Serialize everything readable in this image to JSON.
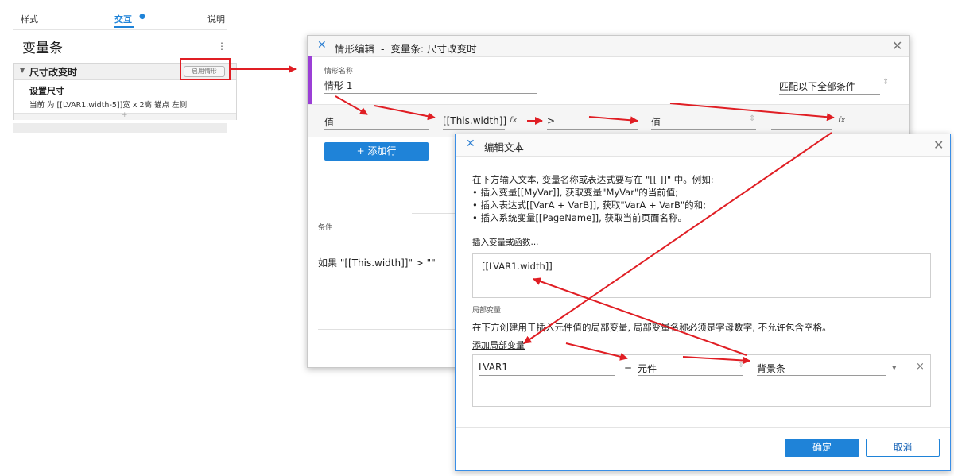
{
  "left_panel": {
    "tabs": [
      "样式",
      "交互",
      "说明"
    ],
    "title": "变量条",
    "more_glyph": "⋮",
    "case": {
      "name": "尺寸改变时",
      "enable_button": "启用情形",
      "action_title": "设置尺寸",
      "action_detail": "当前 为 [[LVAR1.width-5]]宽 x 2高 锚点 左侧",
      "add_glyph": "+"
    }
  },
  "case_dialog": {
    "logo_glyph": "✕",
    "title": "情形编辑  -  变量条: 尺寸改变时",
    "case_name_label": "情形名称",
    "case_name_value": "情形 1",
    "match_select": "匹配以下全部条件",
    "condition_row": {
      "left_type": "值",
      "left_value": "[[This.width]]",
      "fx_glyph": "fx",
      "operator": ">",
      "right_type": "值",
      "right_value": "",
      "right_fx_glyph": "fx"
    },
    "add_row_button": "+ 添加行",
    "conditions_label": "条件",
    "conditions_text": "如果 \"[[This.width]]\" > \"\""
  },
  "text_dialog": {
    "logo_glyph": "✕",
    "title": "编辑文本",
    "help_lines": [
      "在下方输入文本, 变量名称或表达式要写在 \"[[ ]]\" 中。例如:",
      "• 插入变量[[MyVar]], 获取变量\"MyVar\"的当前值;",
      "• 插入表达式[[VarA + VarB]], 获取\"VarA + VarB\"的和;",
      "• 插入系统变量[[PageName]], 获取当前页面名称。"
    ],
    "insert_link": "插入变量或函数...",
    "text_value": "[[LVAR1.width]]",
    "local_vars_label": "局部变量",
    "local_vars_desc": "在下方创建用于插入元件值的局部变量, 局部变量名称必须是字母数字, 不允许包含空格。",
    "add_local_var": "添加局部变量",
    "local_var": {
      "name": "LVAR1",
      "equals": "=",
      "type": "元件",
      "target": "背景条",
      "dropdown_glyph": "▾",
      "delete_glyph": "×"
    },
    "ok_button": "确定",
    "cancel_button": "取消"
  },
  "colors": {
    "accent_blue": "#1f83d8",
    "annotation_red": "#e01e24",
    "case_purple": "#9b3fd6"
  }
}
